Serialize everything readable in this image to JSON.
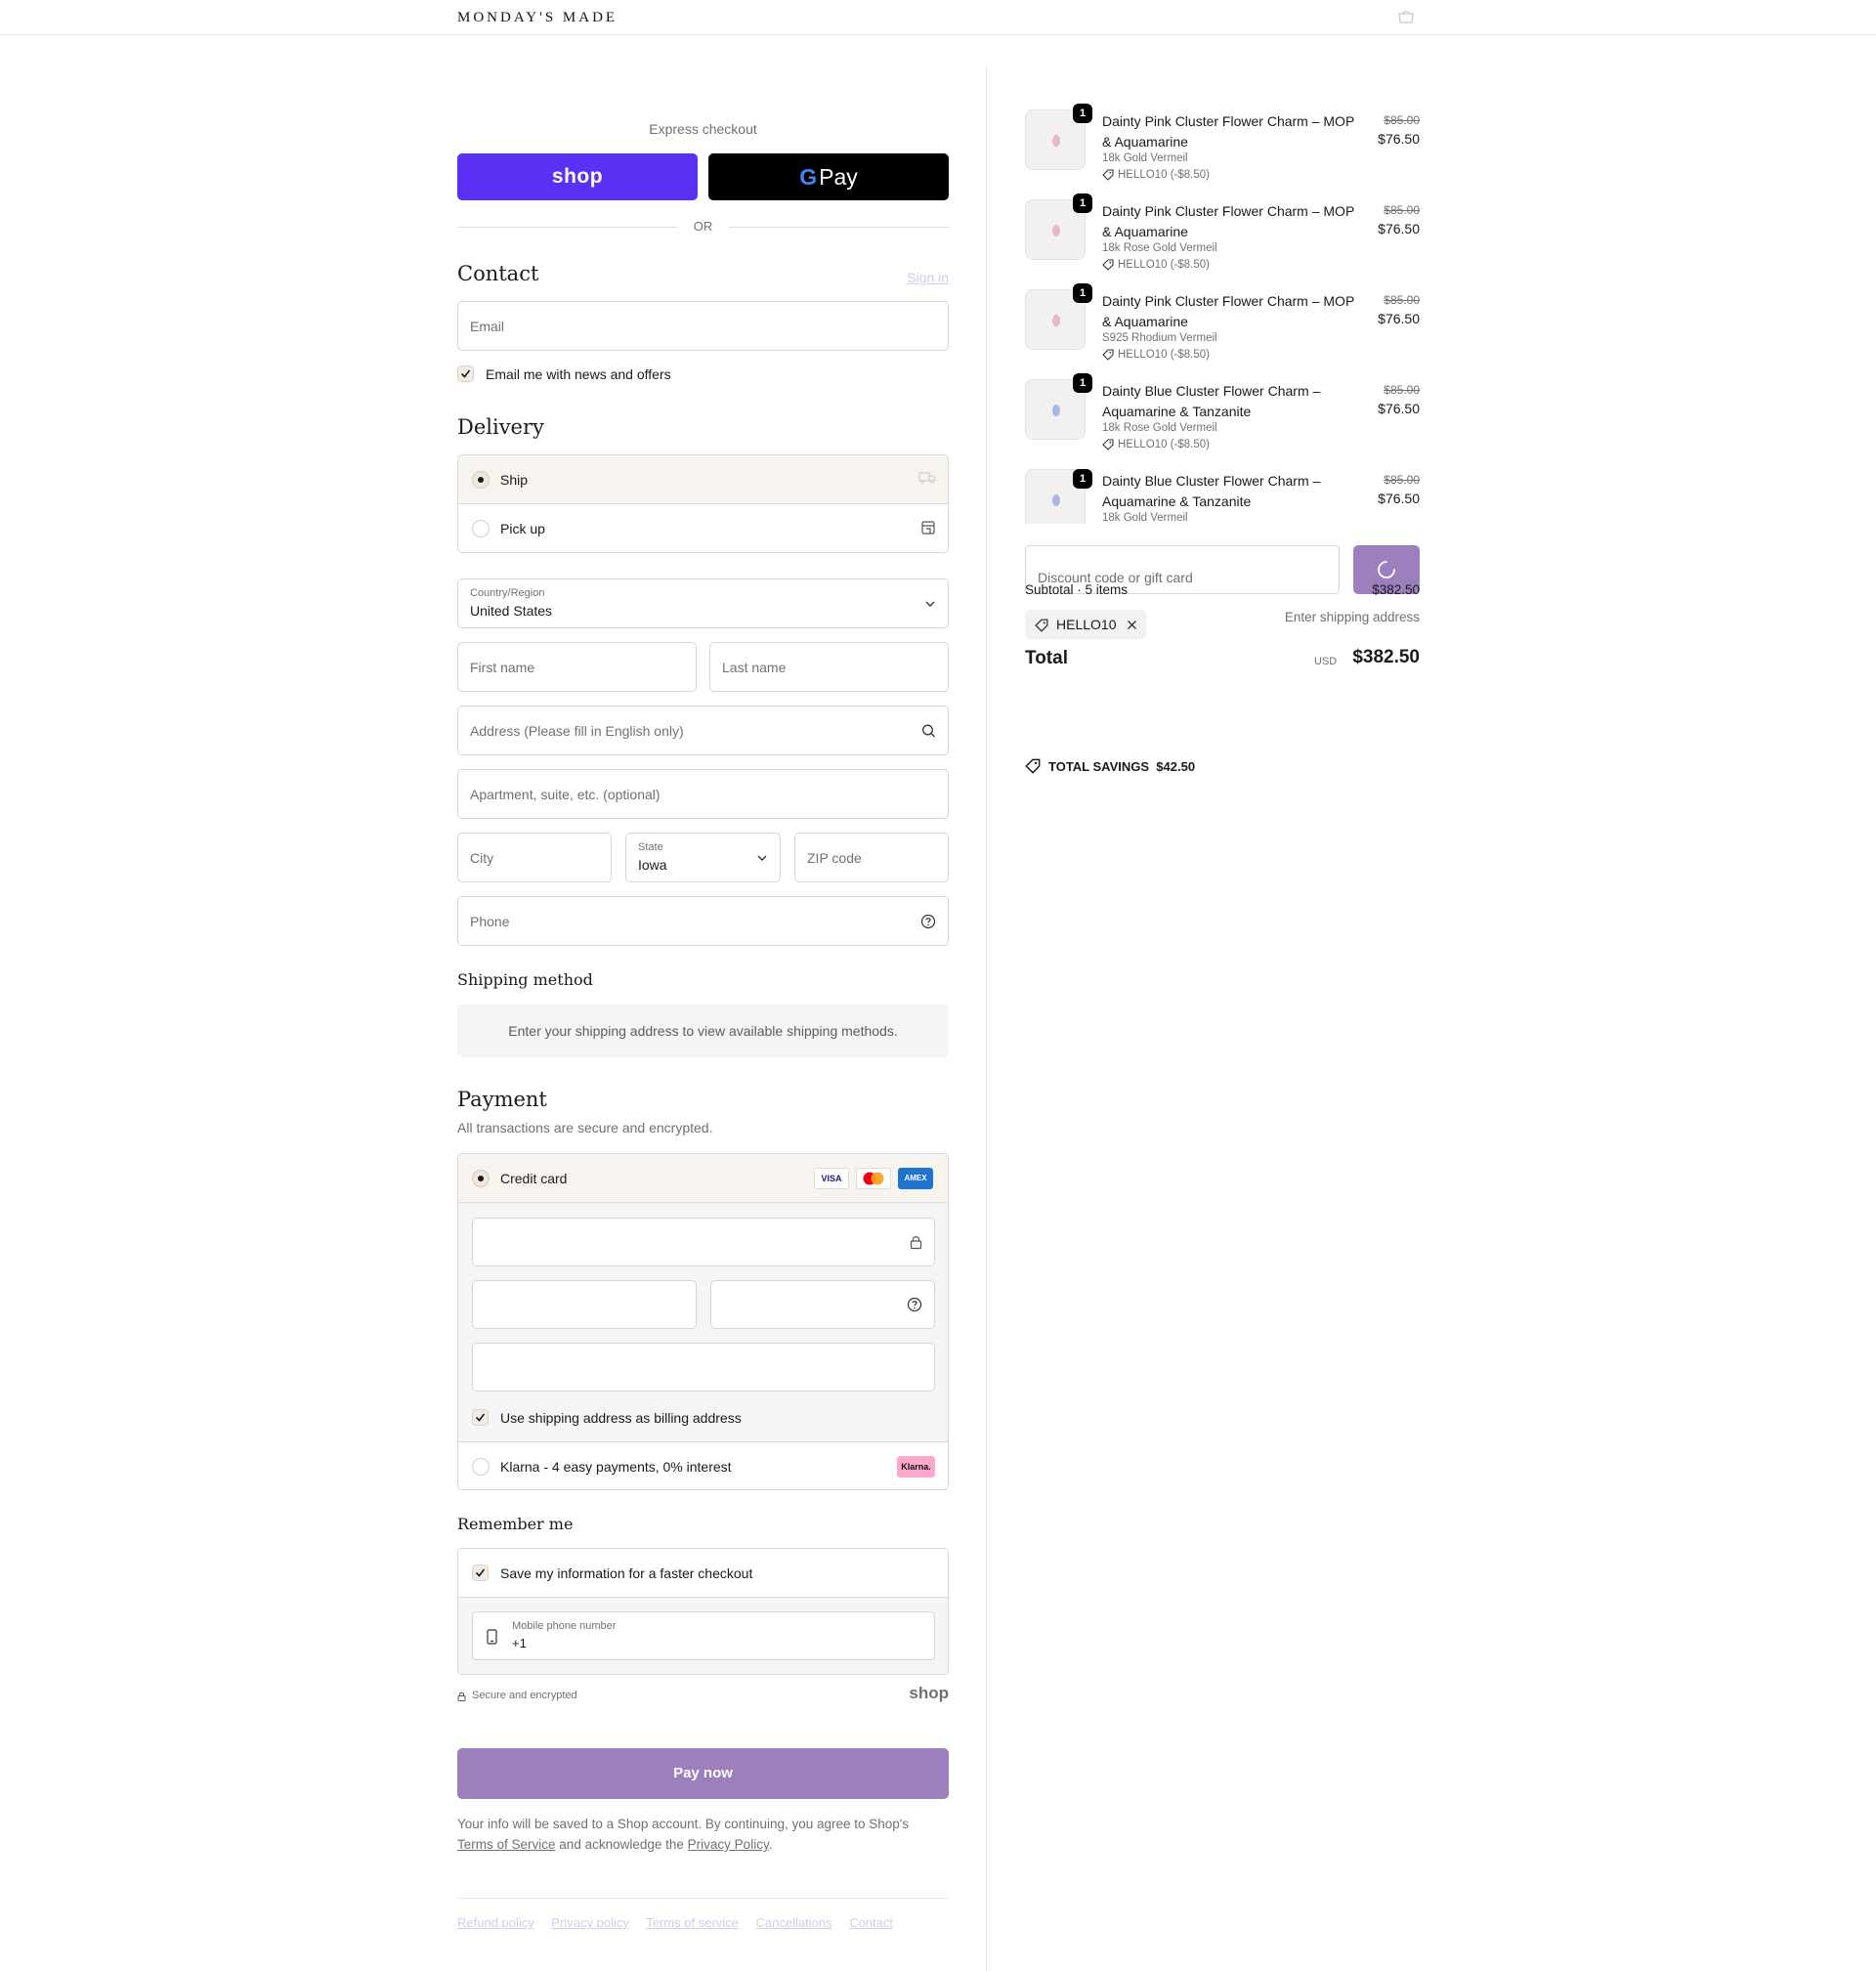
{
  "header": {
    "brand": "MONDAY'S MADE",
    "cart_icon": "bag-icon"
  },
  "express": {
    "label": "Express checkout",
    "shop_label": "shop",
    "gpay_g": "G",
    "gpay_label": "Pay",
    "or_label": "OR"
  },
  "contact": {
    "title": "Contact",
    "signin": "Sign in",
    "email_placeholder": "Email",
    "news_label": "Email me with news and offers"
  },
  "delivery": {
    "title": "Delivery",
    "ship_label": "Ship",
    "pickup_label": "Pick up",
    "country_label": "Country/Region",
    "country_value": "United States",
    "first_name_placeholder": "First name",
    "last_name_placeholder": "Last name",
    "address_placeholder": "Address (Please fill in English only)",
    "apartment_placeholder": "Apartment, suite, etc. (optional)",
    "city_placeholder": "City",
    "state_label": "State",
    "state_value": "Iowa",
    "zip_placeholder": "ZIP code",
    "phone_placeholder": "Phone"
  },
  "shipping_method": {
    "title": "Shipping method",
    "info": "Enter your shipping address to view available shipping methods."
  },
  "payment": {
    "title": "Payment",
    "subtitle": "All transactions are secure and encrypted.",
    "credit_card_label": "Credit card",
    "cards": [
      "VISA",
      "AMEX"
    ],
    "billing_label": "Use shipping address as billing address",
    "klarna_label": "Klarna - 4 easy payments, 0% interest",
    "klarna_badge": "Klarna."
  },
  "remember": {
    "title": "Remember me",
    "save_label": "Save my information for a faster checkout",
    "mobile_label": "Mobile phone number",
    "mobile_value": "+1",
    "secure_label": "Secure and encrypted",
    "shop_logo": "shop"
  },
  "pay_now": "Pay now",
  "legal": {
    "text_1": "Your info will be saved to a Shop account. By continuing, you agree to Shop's",
    "terms": "Terms of Service",
    "text_2": "and acknowledge the",
    "privacy": "Privacy Policy",
    "text_3": "."
  },
  "footer_links": [
    "Refund policy",
    "Privacy policy",
    "Terms of service",
    "Cancellations",
    "Contact"
  ],
  "order": {
    "items": [
      {
        "qty": "1",
        "name": "Dainty Pink Cluster Flower Charm – MOP & Aquamarine",
        "variant": "18k Gold Vermeil",
        "discount": "HELLO10 (-$8.50)",
        "old_price": "$85.00",
        "price": "$76.50",
        "gem_color": "#e7b9c6"
      },
      {
        "qty": "1",
        "name": "Dainty Pink Cluster Flower Charm – MOP & Aquamarine",
        "variant": "18k Rose Gold Vermeil",
        "discount": "HELLO10 (-$8.50)",
        "old_price": "$85.00",
        "price": "$76.50",
        "gem_color": "#e7b9c6"
      },
      {
        "qty": "1",
        "name": "Dainty Pink Cluster Flower Charm – MOP & Aquamarine",
        "variant": "S925 Rhodium Vermeil",
        "discount": "HELLO10 (-$8.50)",
        "old_price": "$85.00",
        "price": "$76.50",
        "gem_color": "#e7b9c6"
      },
      {
        "qty": "1",
        "name": "Dainty Blue Cluster Flower Charm – Aquamarine & Tanzanite",
        "variant": "18k Rose Gold Vermeil",
        "discount": "HELLO10 (-$8.50)",
        "old_price": "$85.00",
        "price": "$76.50",
        "gem_color": "#a9b6e6"
      },
      {
        "qty": "1",
        "name": "Dainty Blue Cluster Flower Charm – Aquamarine & Tanzanite",
        "variant": "18k Gold Vermeil",
        "discount": "",
        "old_price": "$85.00",
        "price": "$76.50",
        "gem_color": "#a9b6e6"
      }
    ],
    "discount_placeholder": "Discount code or gift card",
    "subtotal_label": "Subtotal · 5 items",
    "subtotal_value": "$382.50",
    "applied_code": "HELLO10",
    "shipping_label": "Enter shipping address",
    "total_label": "Total",
    "currency": "USD",
    "total_value": "$382.50",
    "savings_label": "TOTAL SAVINGS",
    "savings_value": "$42.50"
  },
  "colors": {
    "shop_purple": "#5a31f4",
    "pay_button": "#9b80bd",
    "accent_bg": "#f7f4f0"
  }
}
